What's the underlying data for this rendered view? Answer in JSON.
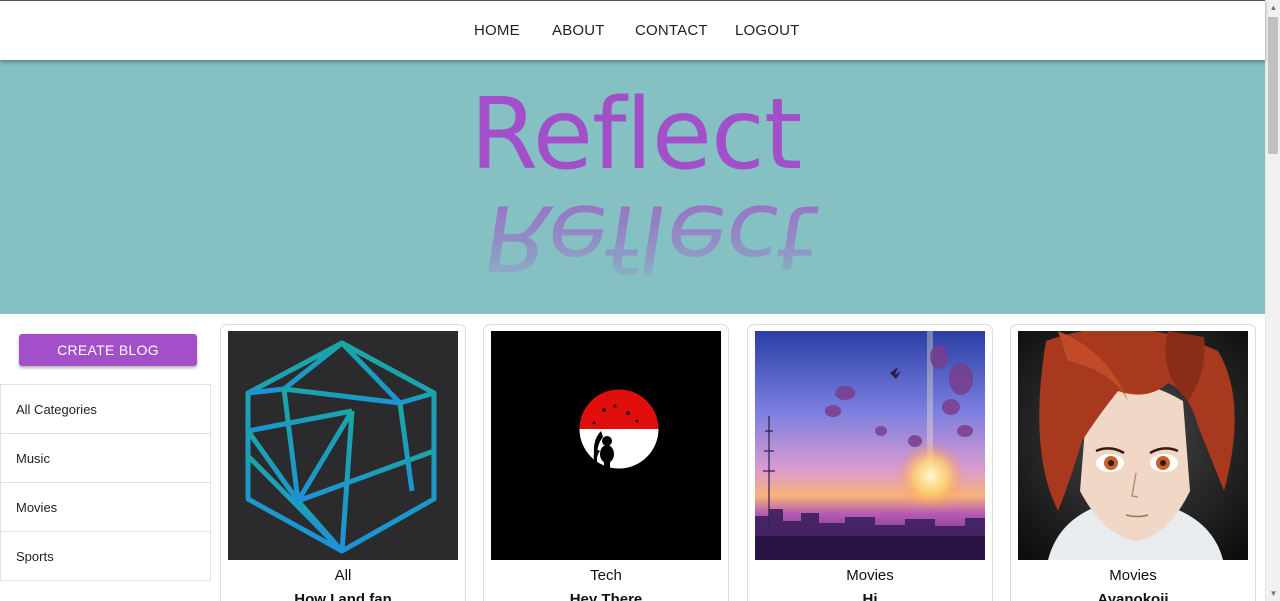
{
  "nav": {
    "home": "HOME",
    "about": "ABOUT",
    "contact": "CONTACT",
    "logout": "LOGOUT"
  },
  "hero": {
    "title": "Reflect",
    "reflection": "Reflect"
  },
  "sidebar": {
    "create_label": "CREATE BLOG",
    "categories": [
      {
        "label": "All Categories"
      },
      {
        "label": "Music"
      },
      {
        "label": "Movies"
      },
      {
        "label": "Sports"
      }
    ]
  },
  "posts": [
    {
      "category": "All",
      "title": "How I and fan",
      "image": "hexagon-network-icon"
    },
    {
      "category": "Tech",
      "title": "Hey There",
      "image": "red-moon-silhouette"
    },
    {
      "category": "Movies",
      "title": "Hi",
      "image": "sunset-city-scene"
    },
    {
      "category": "Movies",
      "title": "Ayanokoji",
      "image": "anime-portrait"
    }
  ],
  "colors": {
    "accent": "#a24fc9",
    "hero_bg": "#85c1c2",
    "nav_text": "#222222"
  },
  "scroll": {
    "position": 0
  }
}
